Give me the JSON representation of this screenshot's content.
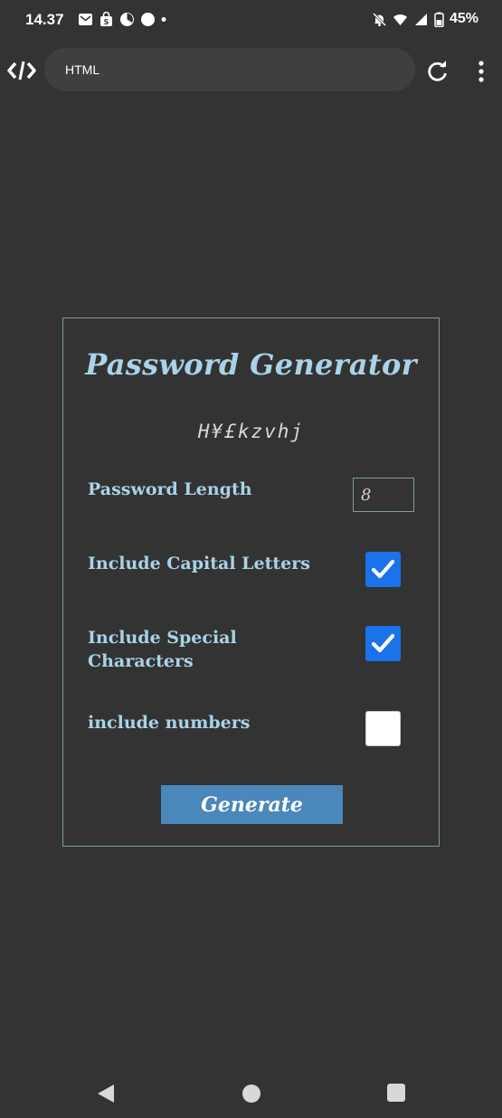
{
  "status_bar": {
    "time": "14.37",
    "battery": "45%"
  },
  "browser": {
    "url": "HTML"
  },
  "generator": {
    "title": "Password Generator",
    "password": "H¥£kzvhj",
    "length_label": "Password Length",
    "length_value": "8",
    "capital_label": "Include Capital Letters",
    "capital_checked": true,
    "special_label_line1": "Include Special",
    "special_label_line2": "Characters",
    "special_checked": true,
    "numbers_label": "include numbers",
    "numbers_checked": false,
    "generate_label": "Generate"
  },
  "colors": {
    "background": "#333333",
    "title": "#a8d3e8",
    "checkbox_checked": "#1a73e8",
    "button": "#4a87ba",
    "border": "#7c9aa4"
  }
}
